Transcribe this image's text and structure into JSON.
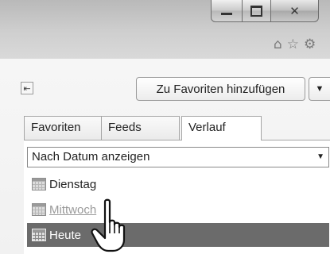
{
  "window": {
    "controls": {
      "minimize_icon": "minimize-icon",
      "maximize_icon": "maximize-icon",
      "close_glyph": "✕"
    },
    "command_icons": {
      "home": "⌂",
      "favorites": "☆",
      "tools": "⚙"
    }
  },
  "favorites_center": {
    "pin_glyph": "⇤",
    "add_button_label": "Zu Favoriten hinzufügen",
    "add_dropdown_glyph": "▼",
    "tabs": [
      {
        "label": "Favoriten",
        "selected": false
      },
      {
        "label": "Feeds",
        "selected": false
      },
      {
        "label": "Verlauf",
        "selected": true
      }
    ],
    "view_select": {
      "value": "Nach Datum anzeigen",
      "arrow": "▼"
    },
    "history_items": [
      {
        "label": "Dienstag",
        "state": "normal"
      },
      {
        "label": "Mittwoch",
        "state": "hover"
      },
      {
        "label": "Heute",
        "state": "selected"
      }
    ]
  },
  "colors": {
    "selected_row_bg": "#6b6b6b",
    "hover_text": "#9a9a9a"
  },
  "cursor": "hand-pointer-icon"
}
